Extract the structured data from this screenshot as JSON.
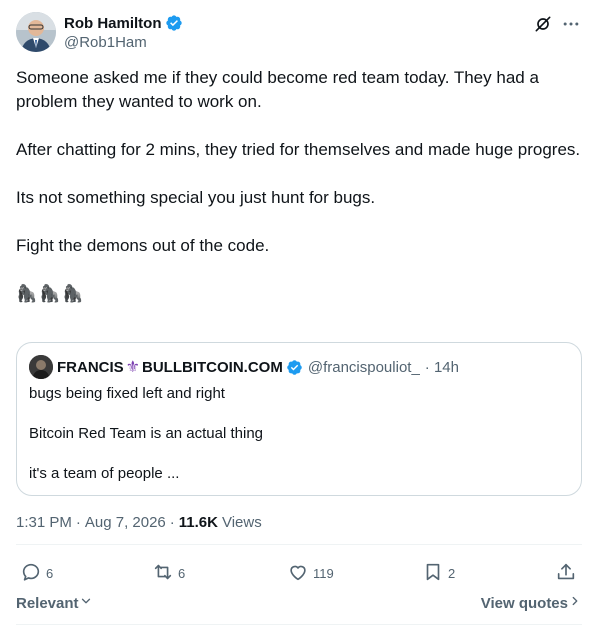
{
  "author": {
    "display_name": "Rob Hamilton",
    "handle": "@Rob1Ham",
    "verified_color": "#1d9bf0"
  },
  "post": {
    "paragraphs": [
      "Someone asked me if they could become red team today. They had a problem they wanted to work on.",
      "After chatting for 2 mins, they tried for themselves and made huge progres.",
      "Its not something special you just hunt for bugs.",
      "Fight the demons out of the code."
    ],
    "emojis": [
      "🦍",
      "🦍",
      "🦍"
    ]
  },
  "quote": {
    "display_name_1": "FRANCIS",
    "fleur": "⚜",
    "display_name_2": "BULLBITCOIN.COM",
    "handle": "@francispouliot_",
    "time": "· 14h",
    "lines": [
      "bugs being fixed left and right",
      "Bitcoin Red Team is an actual thing",
      "it's a team of people ..."
    ]
  },
  "meta": {
    "time": "1:31 PM",
    "dot": "·",
    "date": "Aug 7, 2026",
    "dot2": "·",
    "views_count": "11.6K",
    "views_label": "Views"
  },
  "actions": {
    "replies": "6",
    "reposts": "6",
    "likes": "119",
    "bookmarks": "2"
  },
  "footer": {
    "sort_label": "Relevant",
    "view_quotes": "View quotes"
  },
  "icons": {
    "header": [
      "grok-icon",
      "more-icon"
    ],
    "actions": [
      "reply-icon",
      "repost-icon",
      "like-icon",
      "bookmark-icon",
      "share-icon"
    ]
  },
  "colors": {
    "text": "#0f1419",
    "secondary": "#536471",
    "border": "#cfd9de",
    "accent": "#1d9bf0"
  }
}
